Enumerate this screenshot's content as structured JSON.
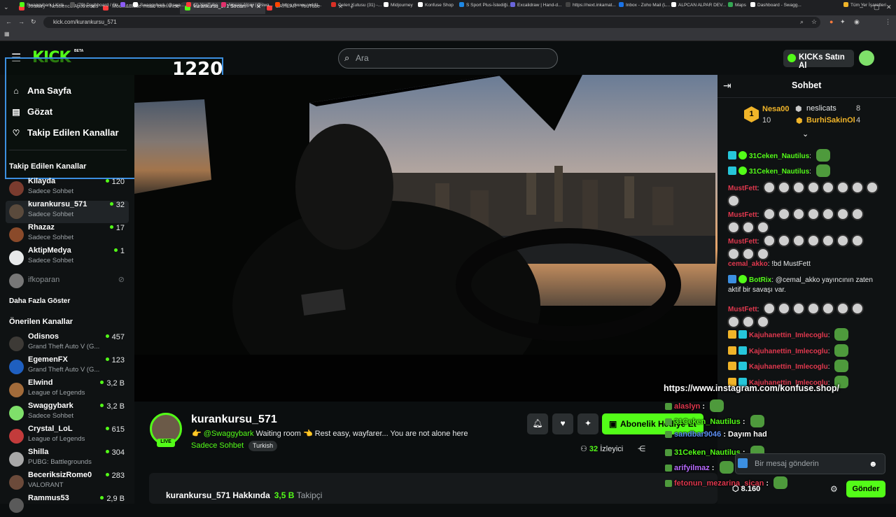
{
  "browser": {
    "tabs": [
      {
        "title": "Journey - Nescience/Apotheosis",
        "color": "#ff3b3b"
      },
      {
        "title": "Mount&Blade music town theme",
        "color": "#ff3b3b"
      },
      {
        "title": "kurankursu_571 Stream - V",
        "color": "#53fc18"
      },
      {
        "title": "DAYILAR - YouTube",
        "color": "#ff3b3b"
      }
    ],
    "url": "kick.com/kurankursu_571",
    "bookmarks": [
      "Swaggybark | Kick",
      "(79) Dashboard / Str...",
      "",
      "Swaggybark (@swa...",
      "(2) YouTube",
      "Alpcan Alpar (@swa...",
      "https://www.reddit...",
      "Gelen Kutusu (31) -...",
      "Midjourney",
      "Konfuse Shop",
      "S Sport Plus-İstediği...",
      "Excalidraw | Hand-d...",
      "https://next.inkamat...",
      "Inbox - Zoho Mail (L...",
      "ALPCAN ALPAR DEV...",
      "Maps",
      "Dashboard - Swagg...",
      "Tüm Yer İşaretleri"
    ]
  },
  "header": {
    "logo": "KICK",
    "beta": "BETA",
    "search_placeholder": "Ara",
    "kicks_button": "KICKs Satın Al"
  },
  "overlay": {
    "number": "1220"
  },
  "sidebar": {
    "nav": [
      {
        "label": "Ana Sayfa",
        "icon": "home-icon"
      },
      {
        "label": "Gözat",
        "icon": "browse-icon"
      },
      {
        "label": "Takip Edilen Kanallar",
        "icon": "heart-icon"
      }
    ],
    "followed_heading": "Takip Edilen Kanallar",
    "followed": [
      {
        "name": "Kilayda",
        "sub": "Sadece Sohbet",
        "viewers": "120"
      },
      {
        "name": "kurankursu_571",
        "sub": "Sadece Sohbet",
        "viewers": "32"
      },
      {
        "name": "Rhazaz",
        "sub": "Sadece Sohbet",
        "viewers": "17"
      },
      {
        "name": "AktipMedya",
        "sub": "Sadece Sohbet",
        "viewers": "1"
      },
      {
        "name": "ifkoparan",
        "sub": "",
        "viewers": ""
      }
    ],
    "show_more": "Daha Fazla Göster",
    "recommended_heading": "Önerilen Kanallar",
    "recommended": [
      {
        "name": "Odisnos",
        "sub": "Grand Theft Auto V (G...",
        "viewers": "457"
      },
      {
        "name": "EgemenFX",
        "sub": "Grand Theft Auto V (G...",
        "viewers": "123"
      },
      {
        "name": "Elwind",
        "sub": "League of Legends",
        "viewers": "3,2 B"
      },
      {
        "name": "Swaggybark",
        "sub": "Sadece Sohbet",
        "viewers": "3,2 B"
      },
      {
        "name": "Crystal_LoL",
        "sub": "League of Legends",
        "viewers": "615"
      },
      {
        "name": "Shilla",
        "sub": "PUBG: Battlegrounds",
        "viewers": "304"
      },
      {
        "name": "BeceriksizRome0",
        "sub": "VALORANT",
        "viewers": "283"
      },
      {
        "name": "Rammus53",
        "sub": "",
        "viewers": "2,9 B"
      }
    ]
  },
  "stream": {
    "streamer": "kurankursu_571",
    "live": "LIVE",
    "title_pre": "👉 ",
    "mention": "@Swaggybark",
    "title_post": " Waiting room 👈 Rest easy, wayfarer... You are not alone here",
    "category": "Sadece Sohbet",
    "language": "Turkish",
    "gift_button": "Abonelik Hediye Et",
    "viewers_count": "32",
    "viewers_label": "İzleyici",
    "about_title": "kurankursu_571 Hakkında",
    "followers_count": "3,5 B",
    "followers_label": "Takipçi"
  },
  "chat": {
    "title": "Sohbet",
    "leaderboard": [
      {
        "rank": "1",
        "name": "Nesa00",
        "count": "10"
      },
      {
        "name": "neslicats",
        "count": "8"
      },
      {
        "name": "BurhiSakinOl",
        "count": "4"
      }
    ],
    "messages": [
      {
        "user": "31Ceken_Nautilus",
        "color": "#53fc18",
        "text": ""
      },
      {
        "user": "31Ceken_Nautilus",
        "color": "#53fc18",
        "text": ""
      },
      {
        "user": "MustFett",
        "color": "#e0384e",
        "text": ""
      },
      {
        "user": "MustFett",
        "color": "#e0384e",
        "text": ""
      },
      {
        "user": "MustFett",
        "color": "#e0384e",
        "text": ""
      },
      {
        "user": "cemal_akko",
        "color": "#e0384e",
        "text": "!bd MustFett"
      },
      {
        "user": "BotRix",
        "color": "#53fc18",
        "text": "@cemal_akko yayıncının zaten",
        "text2": "aktif bir savaşı var."
      },
      {
        "user": "MustFett",
        "color": "#e0384e",
        "text": ""
      },
      {
        "user": "Kajuhanettin_Imlecoglu",
        "color": "#e0384e",
        "text": ""
      },
      {
        "user": "Kajuhanettin_Imlecoglu",
        "color": "#e0384e",
        "text": ""
      },
      {
        "user": "Kajuhanettin_Imlecoglu",
        "color": "#e0384e",
        "text": ""
      },
      {
        "user": "Kajuhanettin_Imlecoglu",
        "color": "#e0384e",
        "text": ""
      }
    ],
    "overlay_url": "https://www.instagram.com/konfuse.shop/",
    "overlay_lines": [
      {
        "user": "alaslyn",
        "color": "#e0384e",
        "text": ""
      },
      {
        "user": "31Ceken_Nautilus",
        "color": "#53fc18",
        "text": ""
      },
      {
        "user": "sandbar9046",
        "color": "#5b8def",
        "text": "Dayım had"
      },
      {
        "user": "31Ceken_Nautilus",
        "color": "#53fc18",
        "text": ""
      },
      {
        "user": "arifyilmaz",
        "color": "#b86bff",
        "text": ""
      },
      {
        "user": "fetonun_mezarina_sican",
        "color": "#e0384e",
        "text": ""
      }
    ],
    "input_placeholder": "Bir mesaj gönderin",
    "points": "8.160",
    "send_button": "Gönder"
  }
}
